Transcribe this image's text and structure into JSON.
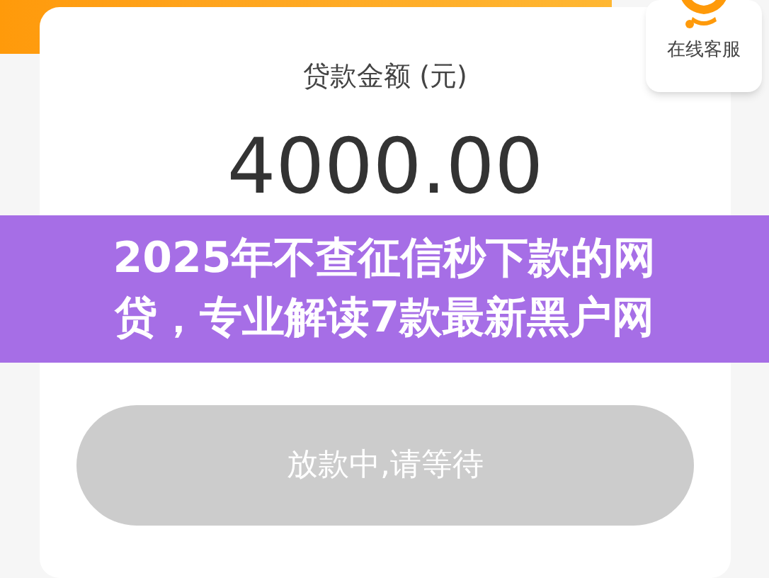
{
  "card": {
    "label": "贷款金额 (元)",
    "amount": "4000.00"
  },
  "support": {
    "label": "在线客服"
  },
  "banner": {
    "lines": [
      "2025年不查征信秒下款的网",
      "贷，专业解读7款最新黑户网"
    ]
  },
  "button": {
    "label": "放款中,请等待",
    "disabled": true
  }
}
